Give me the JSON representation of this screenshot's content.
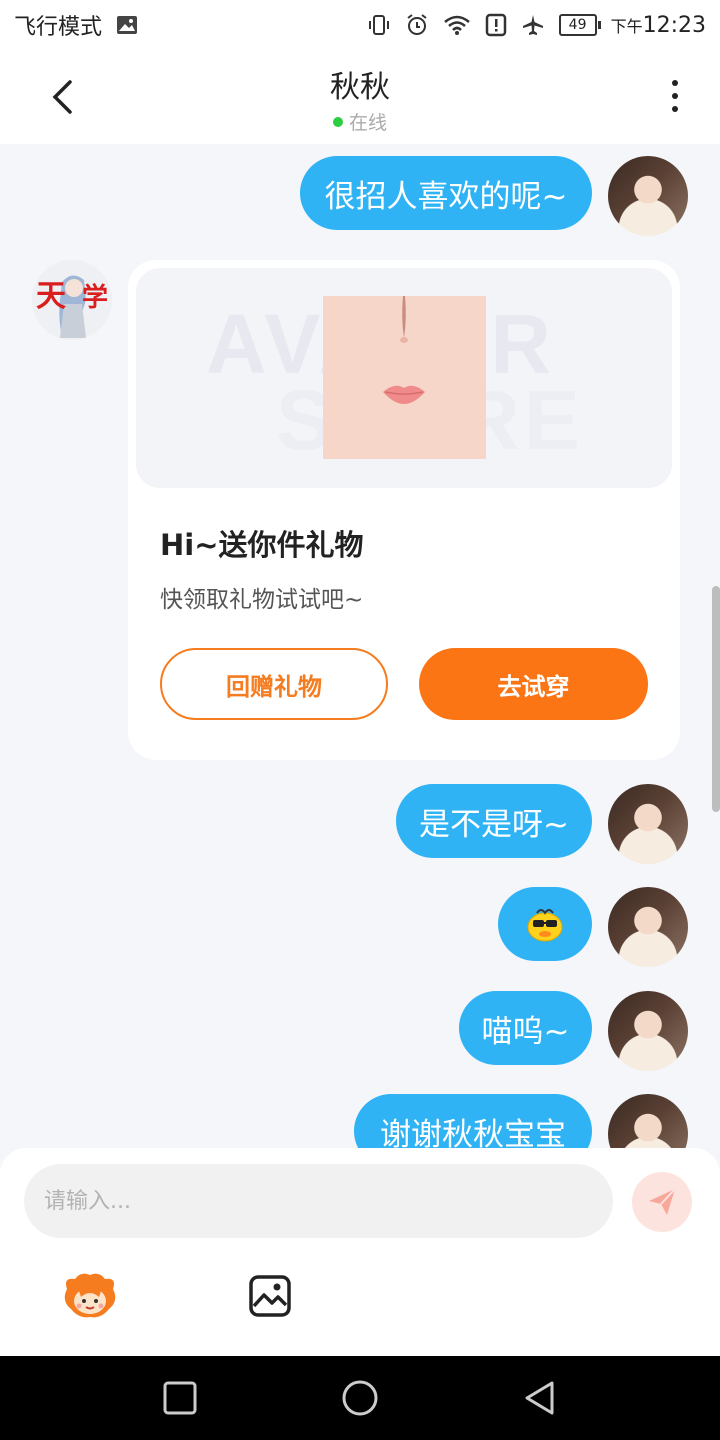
{
  "status_bar": {
    "mode": "飞行模式",
    "battery": "49",
    "time_prefix": "下午",
    "time": "12:23",
    "icons": [
      "image-icon",
      "vibrate-icon",
      "alarm-icon",
      "wifi-icon",
      "alert-icon",
      "airplane-icon",
      "battery-icon"
    ]
  },
  "header": {
    "title": "秋秋",
    "status": "在线",
    "online_color": "#2ecc40"
  },
  "messages": [
    {
      "from": "me",
      "text": "很招人喜欢的呢~"
    },
    {
      "from": "other",
      "type": "gift_card",
      "watermark": [
        "AVATAR",
        "STORE"
      ],
      "title": "Hi~送你件礼物",
      "subtitle": "快领取礼物试试吧~",
      "button_return": "回赠礼物",
      "button_try": "去试穿"
    },
    {
      "from": "me",
      "text": "是不是呀~"
    },
    {
      "from": "me",
      "type": "emoji",
      "icon": "duck-emoji-icon"
    },
    {
      "from": "me",
      "text": "喵呜~"
    },
    {
      "from": "me",
      "text": "谢谢秋秋宝宝"
    }
  ],
  "input": {
    "placeholder": "请输入..."
  },
  "toolbar": {
    "icons": [
      "mascot-sticker-icon",
      "image-gallery-icon"
    ]
  },
  "colors": {
    "bubble": "#2fb3f5",
    "accent_orange": "#fb7514",
    "background": "#f4f6f9"
  },
  "nav": [
    "recent-apps-icon",
    "home-icon",
    "back-triangle-icon"
  ]
}
